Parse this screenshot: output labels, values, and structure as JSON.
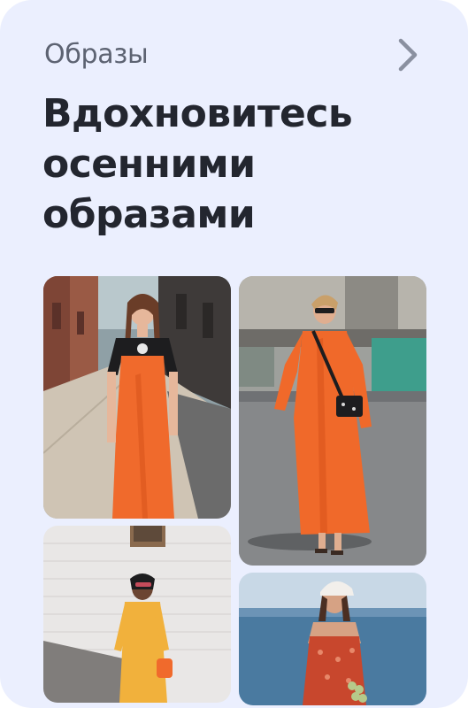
{
  "card": {
    "category": "Образы",
    "title_lines": [
      "Вдохновитесь",
      "осенними",
      "образами"
    ]
  },
  "photos": [
    {
      "subject": "woman in orange slip dress over black t-shirt on city sidewalk"
    },
    {
      "subject": "woman in flowing orange dress with black bag and sunglasses"
    },
    {
      "subject": "woman in mustard yellow dress by white brick wall"
    },
    {
      "subject": "woman in red patterned sundress with white headscarf by the sea"
    }
  ],
  "colors": {
    "card_bg": "#ebeffe",
    "title": "#23262f",
    "category": "#5d6372",
    "chevron": "#8a90a0",
    "dress_orange": "#f06a2c"
  },
  "icons": {
    "next": "chevron-right-icon"
  }
}
